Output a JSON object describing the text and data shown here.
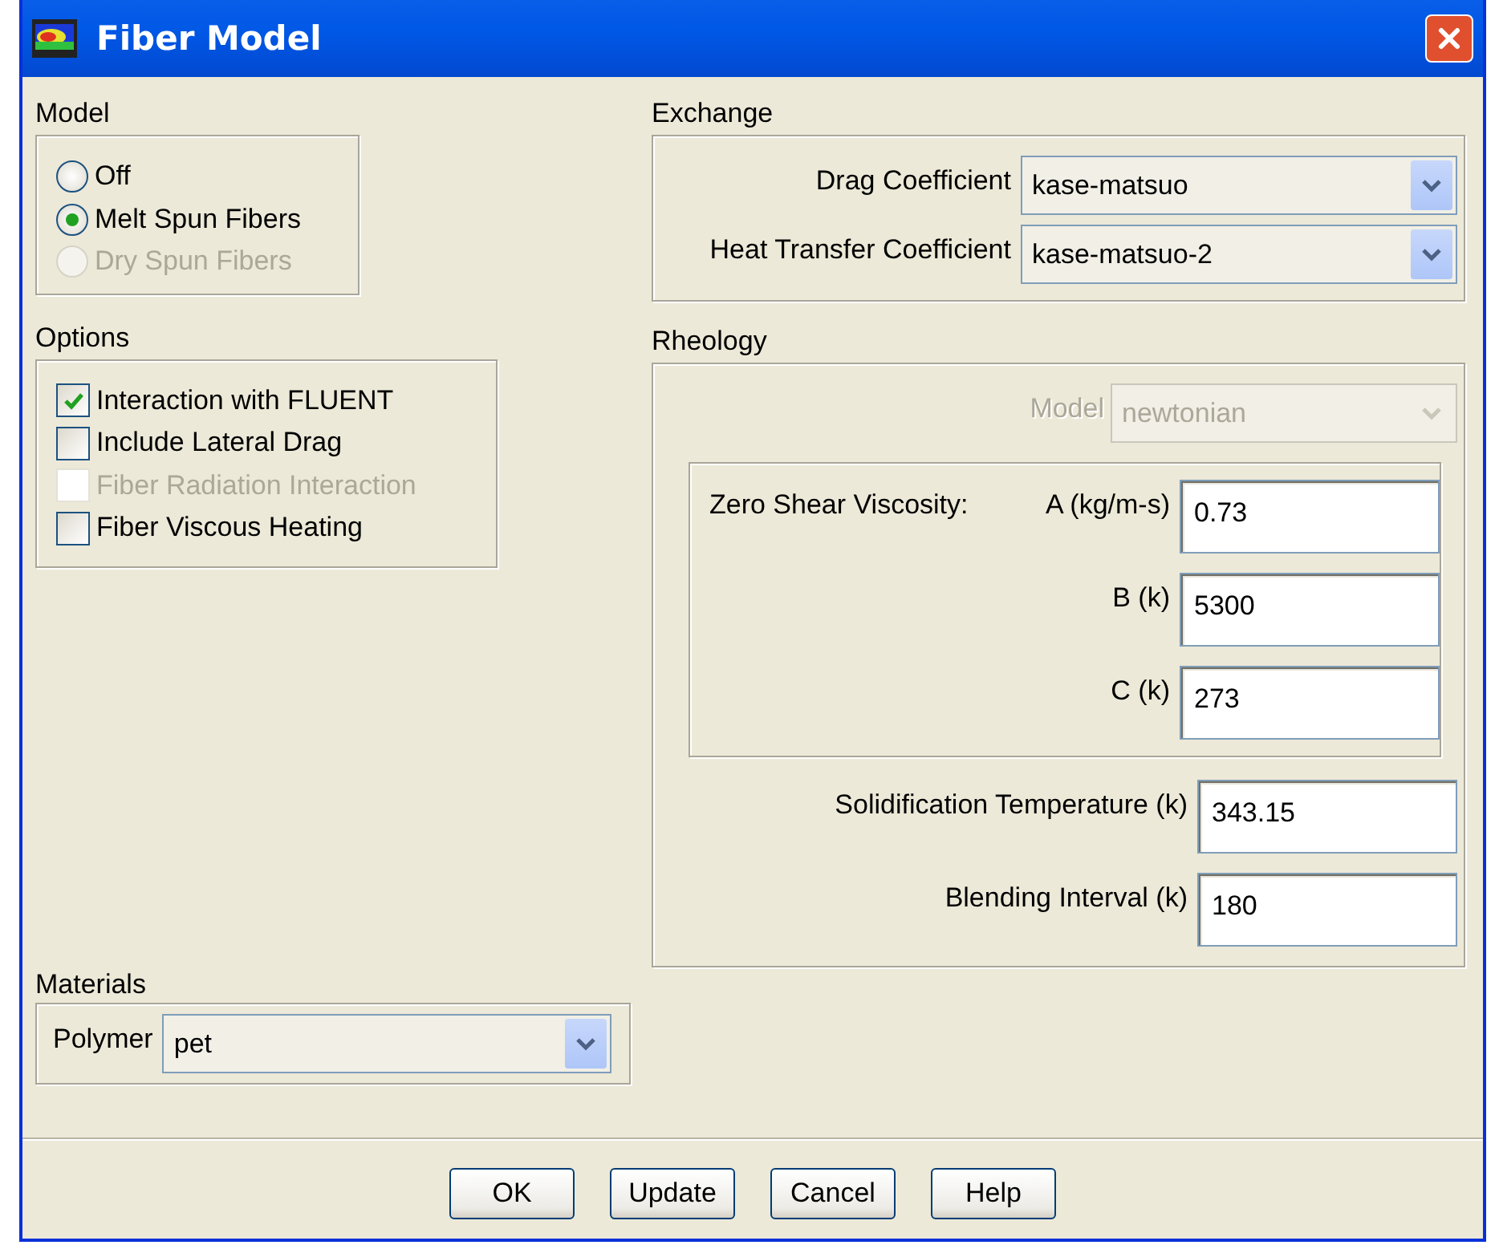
{
  "window": {
    "title": "Fiber Model"
  },
  "model": {
    "title": "Model",
    "options": [
      {
        "label": "Off",
        "selected": false,
        "disabled": false
      },
      {
        "label": "Melt Spun Fibers",
        "selected": true,
        "disabled": false
      },
      {
        "label": "Dry Spun Fibers",
        "selected": false,
        "disabled": true
      }
    ]
  },
  "options": {
    "title": "Options",
    "items": [
      {
        "label": "Interaction with FLUENT",
        "checked": true,
        "disabled": false
      },
      {
        "label": "Include Lateral Drag",
        "checked": false,
        "disabled": false
      },
      {
        "label": "Fiber Radiation Interaction",
        "checked": false,
        "disabled": true
      },
      {
        "label": "Fiber Viscous Heating",
        "checked": false,
        "disabled": false
      }
    ]
  },
  "exchange": {
    "title": "Exchange",
    "fields": [
      {
        "label": "Drag Coefficient",
        "value": "kase-matsuo"
      },
      {
        "label": "Heat Transfer Coefficient",
        "value": "kase-matsuo-2"
      }
    ]
  },
  "rheology": {
    "title": "Rheology",
    "model": {
      "label": "Model",
      "value": "newtonian",
      "disabled": true
    },
    "viscosity": {
      "title": "Zero Shear Viscosity:",
      "fields": [
        {
          "label": "A (kg/m-s)",
          "value": "0.73"
        },
        {
          "label": "B (k)",
          "value": "5300"
        },
        {
          "label": "C (k)",
          "value": "273"
        }
      ]
    },
    "fields": [
      {
        "label": "Solidification Temperature (k)",
        "value": "343.15"
      },
      {
        "label": "Blending Interval (k)",
        "value": "180"
      }
    ]
  },
  "materials": {
    "title": "Materials",
    "field": {
      "label": "Polymer",
      "value": "pet"
    }
  },
  "buttons": [
    "OK",
    "Update",
    "Cancel",
    "Help"
  ]
}
